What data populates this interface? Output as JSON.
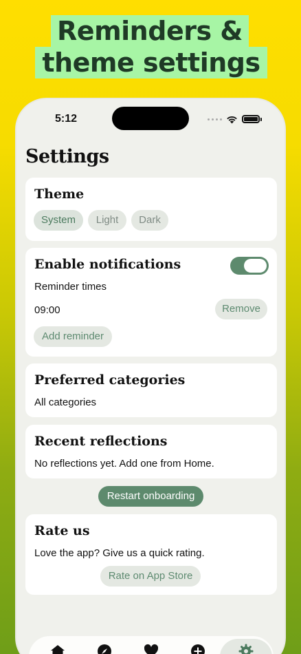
{
  "promo": {
    "line1": "Reminders &",
    "line2": "theme settings"
  },
  "status_bar": {
    "time": "5:12"
  },
  "screen": {
    "title": "Settings"
  },
  "theme": {
    "title": "Theme",
    "options": [
      "System",
      "Light",
      "Dark"
    ],
    "selected": "System"
  },
  "notifications": {
    "title": "Enable notifications",
    "enabled": true,
    "reminder_times_label": "Reminder times",
    "times": [
      "09:00"
    ],
    "remove_label": "Remove",
    "add_label": "Add reminder"
  },
  "categories": {
    "title": "Preferred categories",
    "value": "All categories"
  },
  "reflections": {
    "title": "Recent reflections",
    "empty_text": "No reflections yet. Add one from Home."
  },
  "onboarding": {
    "restart_label": "Restart onboarding"
  },
  "rate": {
    "title": "Rate us",
    "text": "Love the app? Give us a quick rating.",
    "button_label": "Rate on App Store"
  },
  "tabbar": {
    "tabs": [
      "home-icon",
      "compass-icon",
      "heart-icon",
      "plus-circle-icon",
      "gear-icon"
    ],
    "active": "gear-icon"
  },
  "colors": {
    "accent": "#5d8a6d",
    "pill_bg": "#e4e8e2",
    "headline_bg": "#a7f5a5"
  }
}
